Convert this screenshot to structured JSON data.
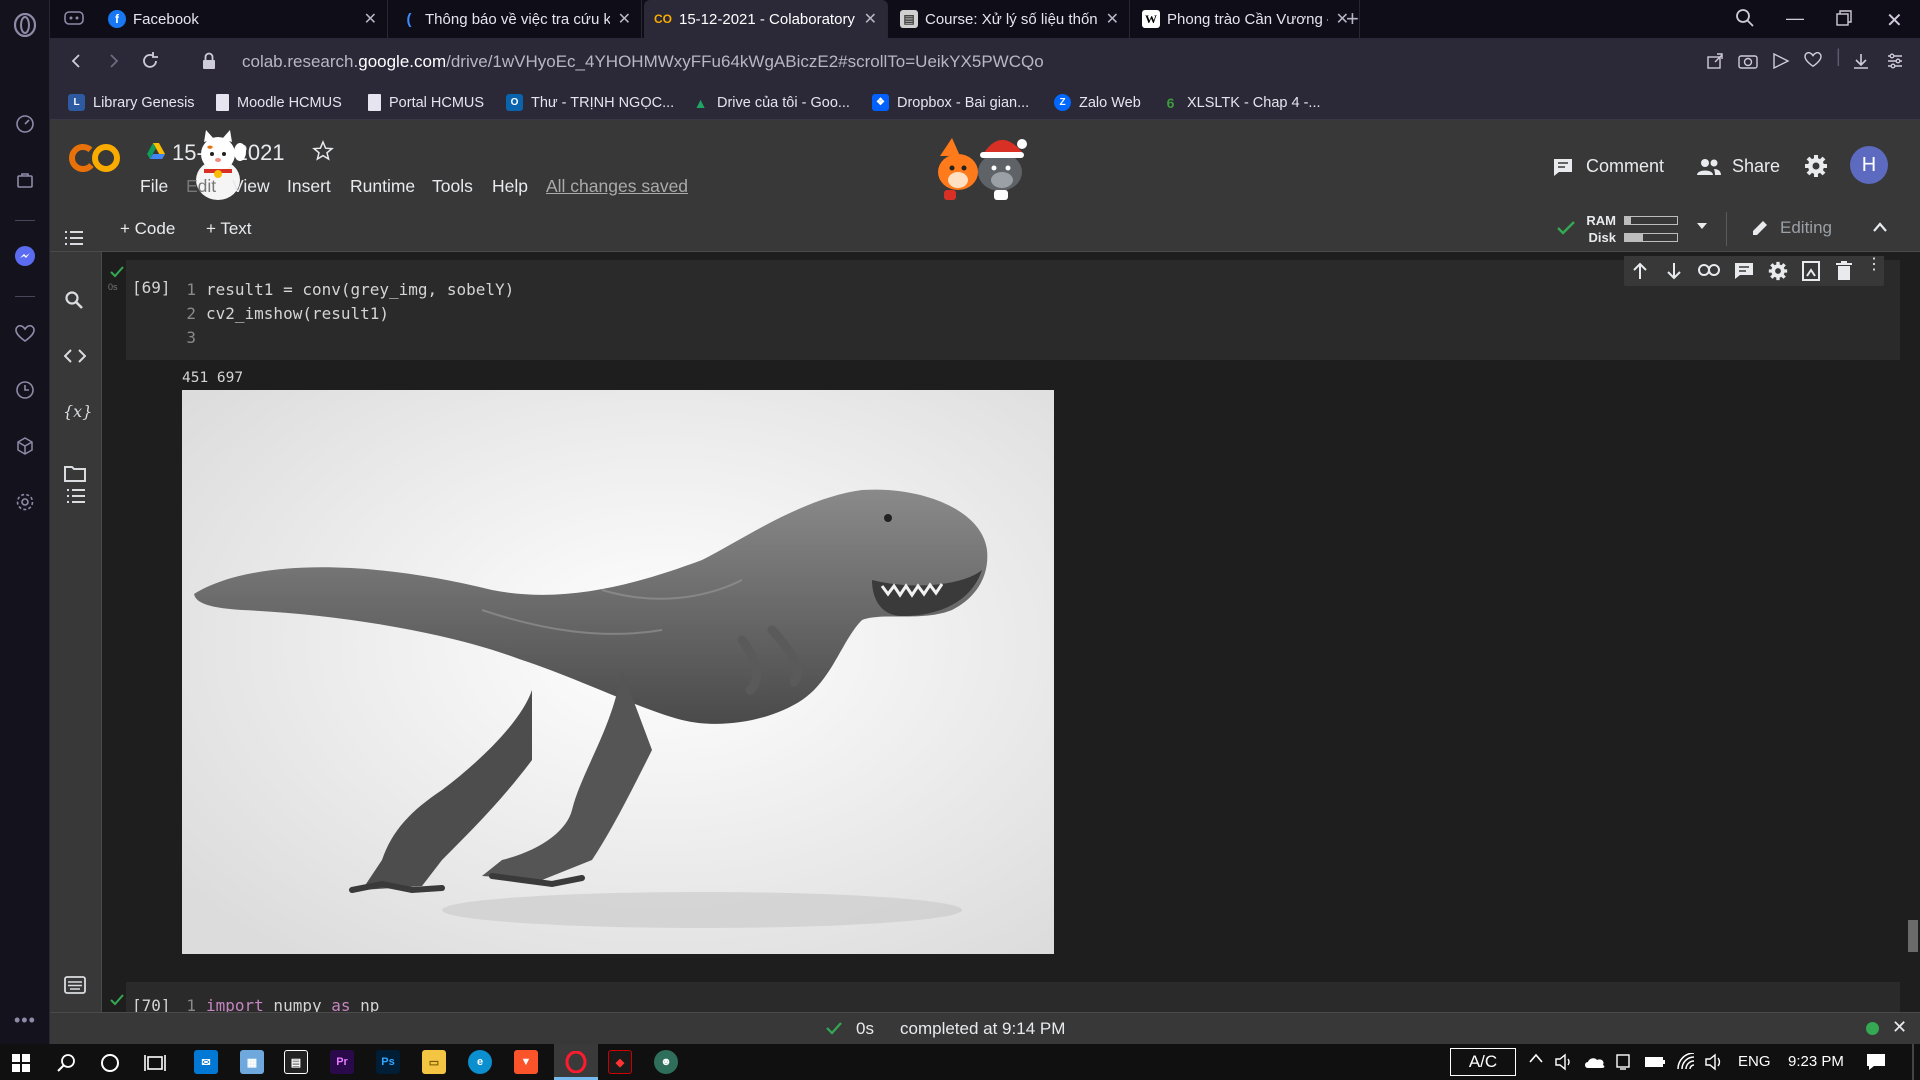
{
  "browser": {
    "tabs": [
      {
        "title": "Facebook",
        "icon": "facebook-icon",
        "color": "#1877f2",
        "glyph": "f"
      },
      {
        "title": "Thông báo về việc tra cứu k",
        "icon": "moodle-icon",
        "color": "#f98012",
        "glyph": "("
      },
      {
        "title": "15-12-2021 - Colaboratory",
        "icon": "colab-icon",
        "color": "#f9ab00",
        "glyph": "CO",
        "active": true
      },
      {
        "title": "Course: Xử lý số liệu thống",
        "icon": "course-icon",
        "color": "#6d6d6d",
        "glyph": "▤"
      },
      {
        "title": "Phong trào Cần Vương – Wi",
        "icon": "wikipedia-icon",
        "color": "#ffffff",
        "glyph": "W"
      }
    ],
    "new_tab": "+",
    "url_prefix": "colab.research.",
    "url_domain": "google.com",
    "url_path": "/drive/1wVHyoEc_4YHOHMWxyFFu64kWgABiczE2#scrollTo=UeikYX5PWCQo"
  },
  "bookmarks": [
    {
      "label": "Library Genesis",
      "icon": "libgen-icon",
      "color": "#2d5aa0",
      "glyph": "L"
    },
    {
      "label": "Moodle HCMUS",
      "icon": "page-icon",
      "color": "#e6e4ee",
      "glyph": ""
    },
    {
      "label": "Portal HCMUS",
      "icon": "page-icon",
      "color": "#e6e4ee",
      "glyph": ""
    },
    {
      "label": "Thư - TRỊNH NGỌC...",
      "icon": "outlook-icon",
      "color": "#0a64ad",
      "glyph": "O"
    },
    {
      "label": "Drive của tôi - Goo...",
      "icon": "drive-icon",
      "color": "#1fa463",
      "glyph": "▲"
    },
    {
      "label": "Dropbox - Bai gian...",
      "icon": "dropbox-icon",
      "color": "#0061fe",
      "glyph": "❖"
    },
    {
      "label": "Zalo Web",
      "icon": "zalo-icon",
      "color": "#0068ff",
      "glyph": "Z"
    },
    {
      "label": "XLSLTK - Chap 4 -...",
      "icon": "xlsltk-icon",
      "color": "#3c9b3c",
      "glyph": "6"
    }
  ],
  "colab": {
    "notebook_title": "15-12-2021",
    "menu": [
      "File",
      "Edit",
      "View",
      "Insert",
      "Runtime",
      "Tools",
      "Help"
    ],
    "save_status": "All changes saved",
    "comment_label": "Comment",
    "share_label": "Share",
    "avatar_letter": "H",
    "add_code": "+ Code",
    "add_text": "+ Text",
    "ram_label": "RAM",
    "disk_label": "Disk",
    "ram_fraction": 0.12,
    "disk_fraction": 0.35,
    "editing_label": "Editing"
  },
  "cells": [
    {
      "exec_count": "[69]",
      "exec_time": "0s",
      "lines": [
        "result1 = conv(grey_img, sobelY)",
        "cv2_imshow(result1)",
        ""
      ],
      "output_text": "451 697"
    },
    {
      "exec_count": "[70]",
      "lines_kw": [
        {
          "kw1": "import",
          "mid": " numpy ",
          "kw2": "as",
          "rest": " np"
        }
      ]
    }
  ],
  "status": {
    "elapsed": "0s",
    "completed": "completed at 9:14 PM"
  },
  "taskbar": {
    "ac_label": "A/C",
    "lang": "ENG",
    "time": "9:23 PM"
  }
}
